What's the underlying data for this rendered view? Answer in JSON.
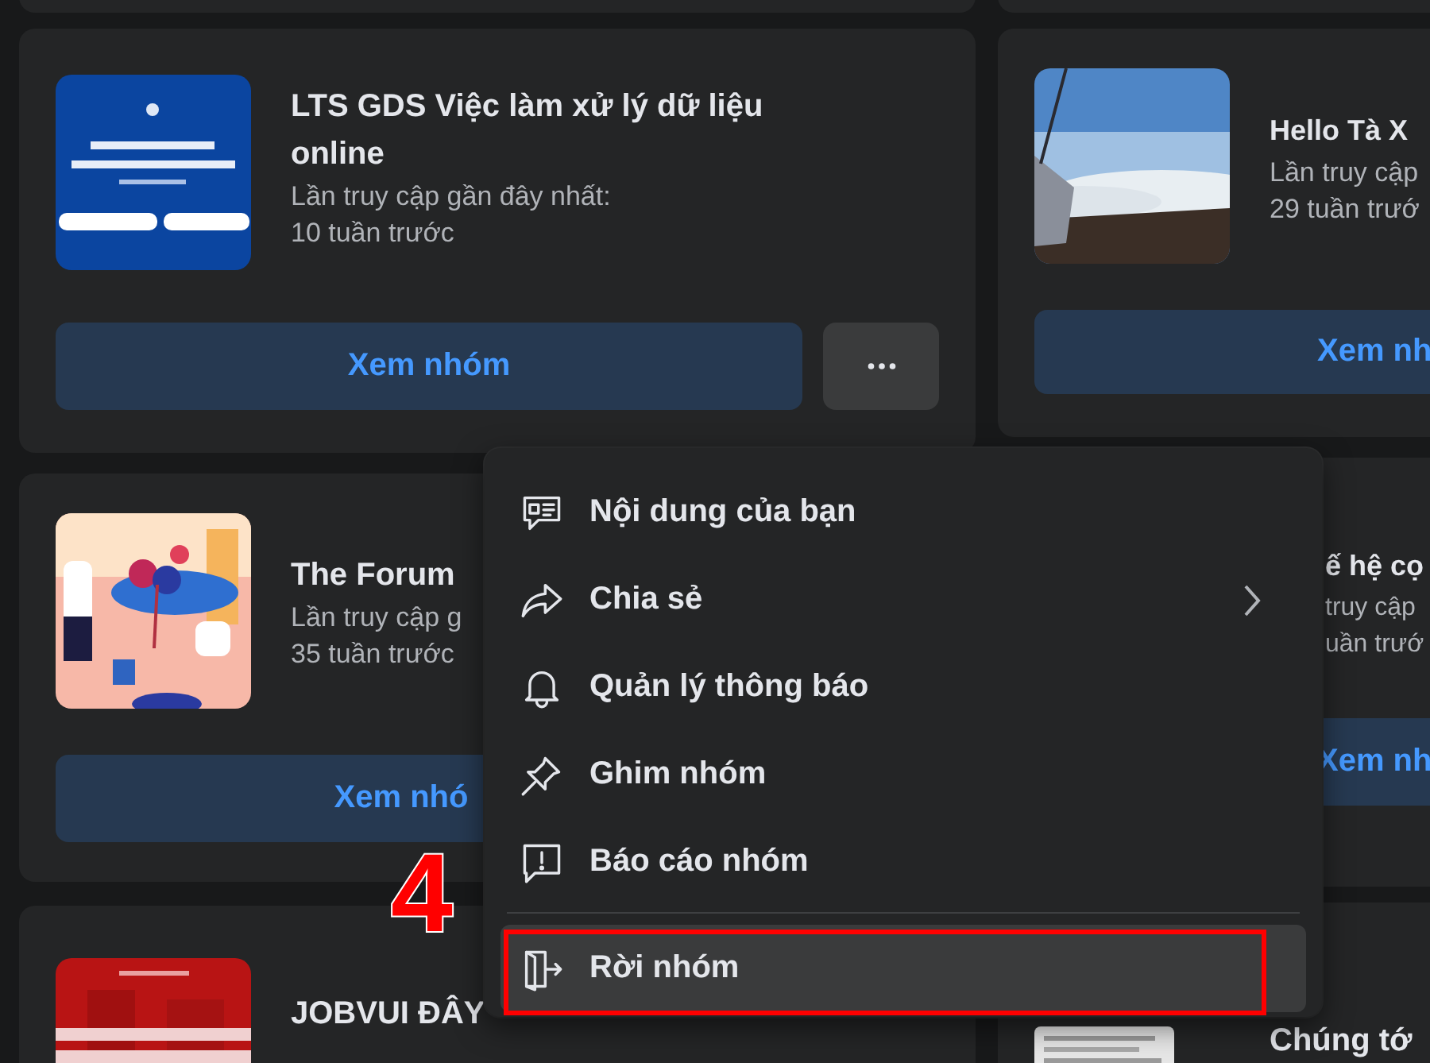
{
  "group_cards": [
    {
      "title": "LTS GDS Việc làm xử lý dữ liệu online",
      "visit_label": "Lần truy cập gần đây nhất:",
      "visit_time": "10 tuần trước",
      "button": "Xem nhóm"
    },
    {
      "title": "Hello Tà X",
      "visit_label": "Lần truy cập",
      "visit_time": "29 tuần trướ",
      "button": "Xem nh"
    },
    {
      "title": "The Forum",
      "visit_label": "Lần truy cập g",
      "visit_time": "35 tuần trước",
      "button": "Xem nhó"
    },
    {
      "title": "ế hệ cọ",
      "visit_label": "truy cập",
      "visit_time": "uần trướ",
      "button": "Xem nh"
    },
    {
      "title": "JOBVUI ĐÂY"
    },
    {
      "title": "Chúng tớ"
    }
  ],
  "menu": {
    "items": [
      {
        "label": "Nội dung của bạn",
        "submenu": false,
        "highlighted": false
      },
      {
        "label": "Chia sẻ",
        "submenu": true,
        "highlighted": false
      },
      {
        "label": "Quản lý thông báo",
        "submenu": false,
        "highlighted": false
      },
      {
        "label": "Ghim nhóm",
        "submenu": false,
        "highlighted": false
      },
      {
        "label": "Báo cáo nhóm",
        "submenu": false,
        "highlighted": false
      },
      {
        "label": "Rời nhóm",
        "submenu": false,
        "highlighted": true
      }
    ]
  },
  "annotation": {
    "step": "4"
  }
}
